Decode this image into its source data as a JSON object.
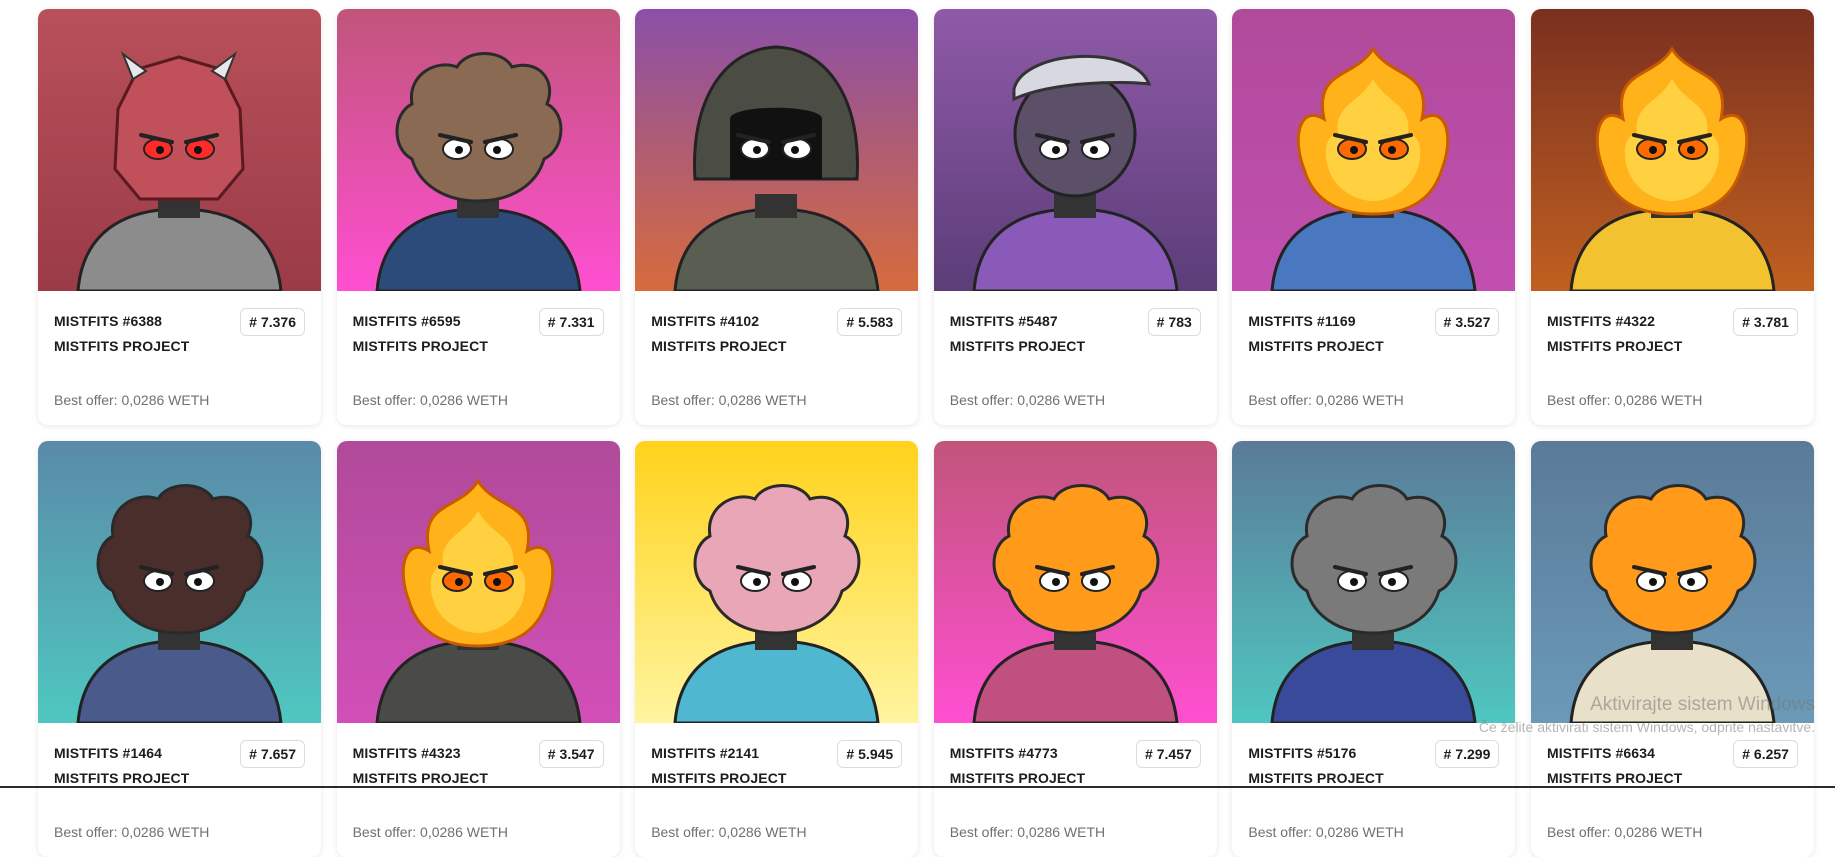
{
  "cards": [
    {
      "name": "MISTFITS #6388",
      "rank": "7.376",
      "collection": "MISTFITS PROJECT",
      "offer": "Best offer: 0,0286 WETH",
      "bg": "#b8505a",
      "bg2": "#9a3b47",
      "head": "#c0505a",
      "style": "robot",
      "eyes": "#ff2b2b",
      "body": "#8c8c8c"
    },
    {
      "name": "MISTFITS #6595",
      "rank": "7.331",
      "collection": "MISTFITS PROJECT",
      "offer": "Best offer: 0,0286 WETH",
      "bg": "#c0557a",
      "bg2": "#ff4fd1",
      "head": "#8a6a52",
      "style": "cloud",
      "eyes": "#ffffff",
      "body": "#2d4b7a"
    },
    {
      "name": "MISTFITS #4102",
      "rank": "5.583",
      "collection": "MISTFITS PROJECT",
      "offer": "Best offer: 0,0286 WETH",
      "bg": "#8a4fa8",
      "bg2": "#d66b3d",
      "head": "#4b4d45",
      "style": "hood",
      "eyes": "#ffffff",
      "body": "#5a5e52"
    },
    {
      "name": "MISTFITS #5487",
      "rank": "783",
      "collection": "MISTFITS PROJECT",
      "offer": "Best offer: 0,0286 WETH",
      "bg": "#8f5aa8",
      "bg2": "#5b3d78",
      "head": "#5b5068",
      "style": "cap",
      "eyes": "#ffffff",
      "body": "#8a5ab8"
    },
    {
      "name": "MISTFITS #1169",
      "rank": "3.527",
      "collection": "MISTFITS PROJECT",
      "offer": "Best offer: 0,0286 WETH",
      "bg": "#b04a9a",
      "bg2": "#c24fb0",
      "head": "#ffb21a",
      "style": "fire",
      "eyes": "#ff6a00",
      "body": "#4a78c0"
    },
    {
      "name": "MISTFITS #4322",
      "rank": "3.781",
      "collection": "MISTFITS PROJECT",
      "offer": "Best offer: 0,0286 WETH",
      "bg": "#7a3020",
      "bg2": "#c06020",
      "head": "#ffb21a",
      "style": "fire",
      "eyes": "#ff6a00",
      "body": "#f2c230"
    },
    {
      "name": "MISTFITS #1464",
      "rank": "7.657",
      "collection": "MISTFITS PROJECT",
      "offer": "Best offer: 0,0286 WETH",
      "bg": "#5a8aa8",
      "bg2": "#4fc7c0",
      "head": "#4a2e2c",
      "style": "cloud",
      "eyes": "#ffffff",
      "body": "#4a5a8a"
    },
    {
      "name": "MISTFITS #4323",
      "rank": "3.547",
      "collection": "MISTFITS PROJECT",
      "offer": "Best offer: 0,0286 WETH",
      "bg": "#b04a9a",
      "bg2": "#d24fb8",
      "head": "#ffb21a",
      "style": "fire",
      "eyes": "#ff6a00",
      "body": "#4a4a48"
    },
    {
      "name": "MISTFITS #2141",
      "rank": "5.945",
      "collection": "MISTFITS PROJECT",
      "offer": "Best offer: 0,0286 WETH",
      "bg": "#ffd21a",
      "bg2": "#fff5a0",
      "head": "#e8a6b6",
      "style": "cloud",
      "eyes": "#ffffff",
      "body": "#4fb8d0"
    },
    {
      "name": "MISTFITS #4773",
      "rank": "7.457",
      "collection": "MISTFITS PROJECT",
      "offer": "Best offer: 0,0286 WETH",
      "bg": "#c0557a",
      "bg2": "#ff4fd1",
      "head": "#ff9a1a",
      "style": "cloud",
      "eyes": "#ffffff",
      "body": "#c05080"
    },
    {
      "name": "MISTFITS #5176",
      "rank": "7.299",
      "collection": "MISTFITS PROJECT",
      "offer": "Best offer: 0,0286 WETH",
      "bg": "#5a7a98",
      "bg2": "#4fc7c0",
      "head": "#7a7a7a",
      "style": "cloud",
      "eyes": "#ffffff",
      "body": "#3a4a9a"
    },
    {
      "name": "MISTFITS #6634",
      "rank": "6.257",
      "collection": "MISTFITS PROJECT",
      "offer": "Best offer: 0,0286 WETH",
      "bg": "#5a7a98",
      "bg2": "#6a9ab8",
      "head": "#ff9a1a",
      "style": "cloud",
      "eyes": "#ffffff",
      "body": "#e8e0c8"
    }
  ],
  "watermark": {
    "line1": "Aktivirajte sistem Windows",
    "line2": "Če želite aktivirati sistem Windows, odprite nastavitve."
  }
}
